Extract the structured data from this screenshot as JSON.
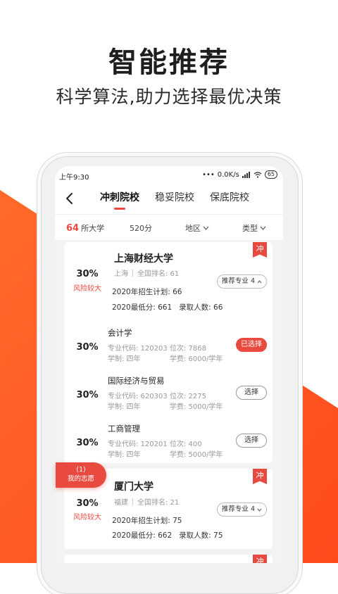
{
  "promo": {
    "title": "智能推荐",
    "subtitle": "科学算法,助力选择最优决策"
  },
  "colors": {
    "accent": "#e84a3f",
    "wedge": "#ff5a1f"
  },
  "status": {
    "time": "上午9:30",
    "network": "0.0K/s",
    "battery": "65"
  },
  "nav": {
    "tabs": [
      {
        "label": "冲刺院校",
        "active": true
      },
      {
        "label": "稳妥院校",
        "active": false
      },
      {
        "label": "保底院校",
        "active": false
      }
    ]
  },
  "filter": {
    "count": "64",
    "count_suffix": "所大学",
    "score": "520分",
    "region": "地区",
    "type": "类型"
  },
  "universities": [
    {
      "tag": "冲",
      "probability": "30%",
      "risk": "风险较大",
      "name": "上海财经大学",
      "location": "上海",
      "ranking": "全国排名: 61",
      "plan": "2020年招生计划: 66",
      "min_score": "2020最低分: 661",
      "admitted": "录取人数: 66",
      "recommend": "推荐专业 4",
      "majors": [
        {
          "probability": "30%",
          "name": "会计学",
          "code": "专业代码: 120203",
          "rank": "位次: 7868",
          "duration": "学制: 四年",
          "fee": "学费: 6000/学年",
          "action": "已选择",
          "selected": true
        },
        {
          "probability": "30%",
          "name": "国际经济与贸易",
          "code": "专业代码: 620303",
          "rank": "位次: 2275",
          "duration": "学制: 四年",
          "fee": "学费: 5000/学年",
          "action": "选择",
          "selected": false
        },
        {
          "probability": "30%",
          "name": "工商管理",
          "code": "专业代码: 120201",
          "rank": "位次: 400",
          "duration": "学制: 四年",
          "fee": "学费: 5000/学年",
          "action": "选择",
          "selected": false
        }
      ]
    },
    {
      "tag": "冲",
      "probability": "30%",
      "risk": "风险较大",
      "name": "厦门大学",
      "location": "福建",
      "ranking": "全国排名: 21",
      "plan": "2020年招生计划: 75",
      "min_score": "2020最低分: 662",
      "admitted": "录取人数: 75",
      "recommend": "推荐专业 4"
    }
  ],
  "third_card_tag": "冲",
  "wishlist": {
    "count": "(1)",
    "label": "我的志愿"
  }
}
